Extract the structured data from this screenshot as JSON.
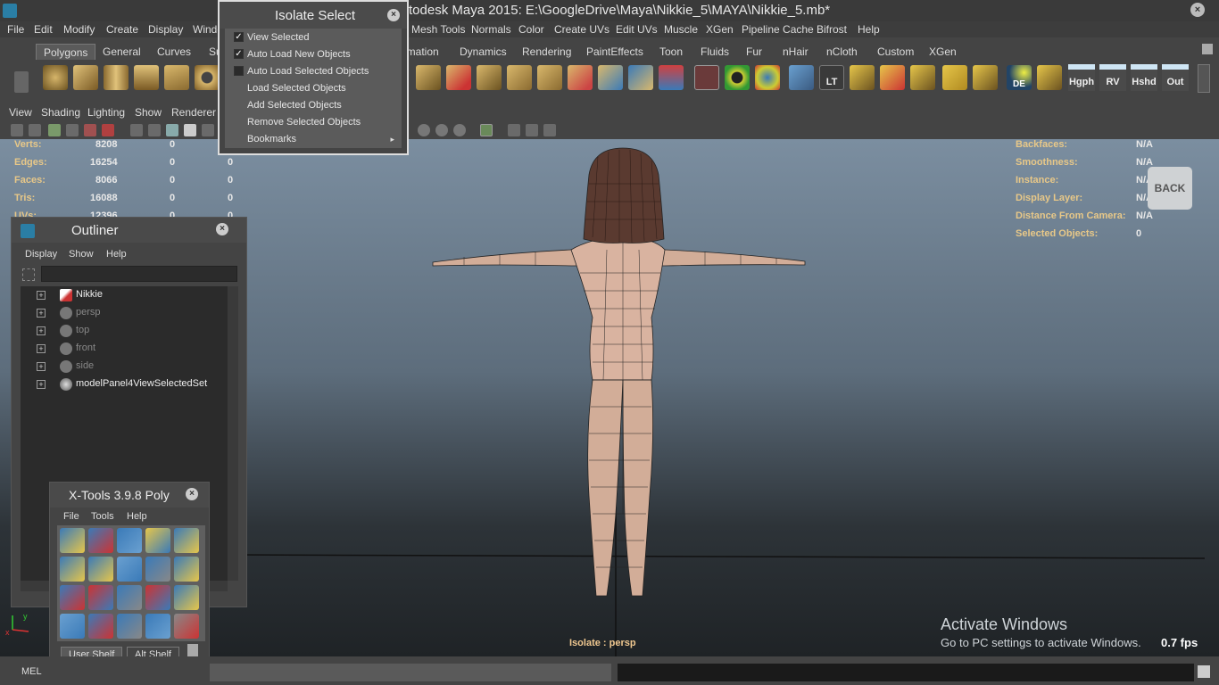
{
  "window": {
    "title": "todesk Maya 2015: E:\\GoogleDrive\\Maya\\Nikkie_5\\MAYA\\Nikkie_5.mb*"
  },
  "menubar": [
    "File",
    "Edit",
    "Modify",
    "Create",
    "Display",
    "Windo",
    "Mesh Tools",
    "Normals",
    "Color",
    "Create UVs",
    "Edit UVs",
    "Muscle",
    "XGen",
    "Pipeline Cache",
    "Bifrost",
    "Help"
  ],
  "shelf_tabs": [
    "Polygons",
    "General",
    "Curves",
    "Su",
    "imation",
    "Dynamics",
    "Rendering",
    "PaintEffects",
    "Toon",
    "Fluids",
    "Fur",
    "nHair",
    "nCloth",
    "Custom",
    "XGen"
  ],
  "shelf_labels": {
    "lt": "LT",
    "de": "DE",
    "hgph": "Hgph",
    "rv": "RV",
    "hshd": "Hshd",
    "out": "Out"
  },
  "panel_menu": [
    "View",
    "Shading",
    "Lighting",
    "Show",
    "Renderer"
  ],
  "hud_left": [
    {
      "label": "Verts:",
      "v1": "8208",
      "v2": "0",
      "v3": "0"
    },
    {
      "label": "Edges:",
      "v1": "16254",
      "v2": "0",
      "v3": "0"
    },
    {
      "label": "Faces:",
      "v1": "8066",
      "v2": "0",
      "v3": "0"
    },
    {
      "label": "Tris:",
      "v1": "16088",
      "v2": "0",
      "v3": "0"
    },
    {
      "label": "UVs:",
      "v1": "12396",
      "v2": "0",
      "v3": "0"
    }
  ],
  "hud_right": [
    {
      "label": "Backfaces:",
      "value": "N/A"
    },
    {
      "label": "Smoothness:",
      "value": "N/A"
    },
    {
      "label": "Instance:",
      "value": "N/A"
    },
    {
      "label": "Display Layer:",
      "value": "N/A"
    },
    {
      "label": "Distance From Camera:",
      "value": "N/A"
    },
    {
      "label": "Selected Objects:",
      "value": "0"
    }
  ],
  "back_button": "BACK",
  "isolate_status": "Isolate : persp",
  "activate_windows": {
    "line1": "Activate Windows",
    "line2": "Go to PC settings to activate Windows."
  },
  "fps": "0.7 fps",
  "axis": {
    "y": "y",
    "x": "x"
  },
  "isolate_select": {
    "title": "Isolate Select",
    "items": [
      {
        "label": "View Selected",
        "checked": true
      },
      {
        "label": "Auto Load New Objects",
        "checked": true
      },
      {
        "label": "Auto Load Selected Objects",
        "checked": false
      },
      {
        "label": "Load Selected Objects"
      },
      {
        "label": "Add Selected Objects"
      },
      {
        "label": "Remove Selected Objects"
      },
      {
        "label": "Bookmarks"
      }
    ]
  },
  "outliner": {
    "title": "Outliner",
    "menu": [
      "Display",
      "Show",
      "Help"
    ],
    "items": [
      {
        "label": "Nikkie",
        "dim": false
      },
      {
        "label": "persp",
        "dim": true
      },
      {
        "label": "top",
        "dim": true
      },
      {
        "label": "front",
        "dim": true
      },
      {
        "label": "side",
        "dim": true
      },
      {
        "label": "modelPanel4ViewSelectedSet",
        "dim": false
      }
    ]
  },
  "xtools": {
    "title": "X-Tools 3.9.8 Poly",
    "menu": [
      "File",
      "Tools",
      "Help"
    ],
    "tabs": [
      "User Shelf",
      "Alt Shelf"
    ]
  },
  "cmdline": {
    "mel": "MEL"
  }
}
